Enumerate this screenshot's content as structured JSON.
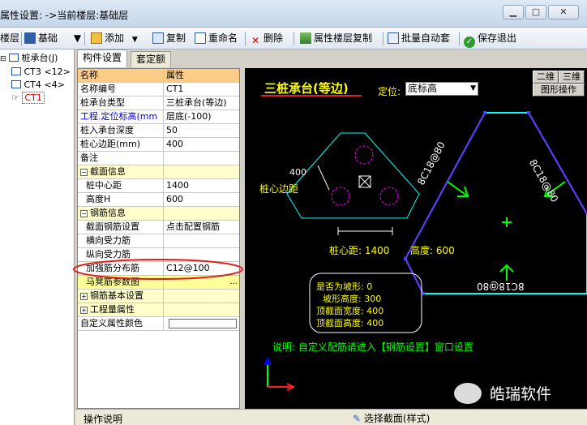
{
  "window": {
    "title": "属性设置: ->当前楼层:基础层"
  },
  "toolbar": {
    "floor_label": "楼层",
    "base_label": "基础",
    "add_label": "添加",
    "copy_label": "复制",
    "rename_label": "重命名",
    "delete_label": "删除",
    "copy_attr_label": "属性楼层复制",
    "batch_label": "批量自动套",
    "save_exit_label": "保存退出"
  },
  "tree": {
    "root": "桩承台(J)",
    "items": [
      "CT3 <12>",
      "CT4 <4>",
      "CT1"
    ]
  },
  "tabs": [
    "构件设置",
    "套定额"
  ],
  "grid": {
    "header": {
      "name": "名称",
      "value": "属性"
    },
    "rows": [
      {
        "name": "名称编号",
        "value": "CT1"
      },
      {
        "name": "桩承台类型",
        "value": "三桩承台(等边)"
      },
      {
        "name": "工程.定位标高(mm",
        "value": "层底(-100)"
      },
      {
        "name": "桩入承台深度",
        "value": "50"
      },
      {
        "name": "桩心边距(mm)",
        "value": "400"
      },
      {
        "name": "备注",
        "value": ""
      },
      {
        "name": "截面信息",
        "value": ""
      },
      {
        "name": "桩中心距",
        "value": "1400"
      },
      {
        "name": "高度H",
        "value": "600"
      },
      {
        "name": "钢筋信息",
        "value": ""
      },
      {
        "name": "截面钢筋设置",
        "value": "点击配置钢筋"
      },
      {
        "name": "横向受力筋",
        "value": ""
      },
      {
        "name": "纵向受力筋",
        "value": ""
      },
      {
        "name": "加强筋分布筋",
        "value": "C12@100"
      },
      {
        "name": "马凳筋参数图",
        "value": ""
      },
      {
        "name": "钢筋基本设置",
        "value": ""
      },
      {
        "name": "工程量属性",
        "value": ""
      },
      {
        "name": "自定义属性颜色",
        "value": ""
      }
    ]
  },
  "canvas": {
    "title": "三桩承台(等边)",
    "locate_label": "定位:",
    "locate_value": "底标高",
    "btn_2d": "二维",
    "btn_3d": "三维",
    "btn_graph": "图形操作",
    "dim_400": "400",
    "edge_label": "桩心边距",
    "pile_spacing": "桩心距: 1400",
    "height": "高度: 600",
    "rebar_top_left": "8C18@80",
    "rebar_top_right": "8C18@80",
    "rebar_bottom": "8C18@80",
    "slope_q": "是否为坡形: 0",
    "slope_h": "坡形高度: 300",
    "top_w": "顶截面宽度: 400",
    "top_h": "顶截面高度: 400",
    "note": "说明: 自定义配筋请进入【钢筋设置】窗口设置"
  },
  "bottom": {
    "ops": "操作说明",
    "select_section": "选择截面(样式)"
  },
  "watermark": "皓瑞软件",
  "colors": {
    "accent_red": "#e00000",
    "canvas_yellow": "#ffff00",
    "canvas_cyan": "#00ffff",
    "canvas_green": "#00ff00",
    "canvas_magenta": "#ff00ff"
  }
}
